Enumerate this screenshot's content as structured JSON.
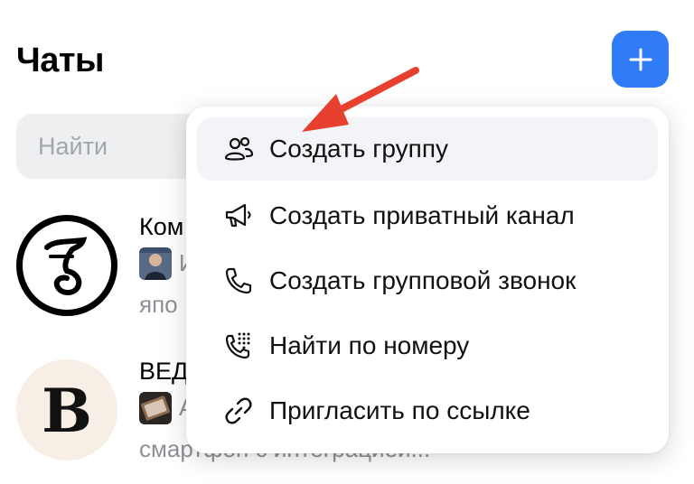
{
  "header": {
    "title": "Чаты",
    "add_icon": "plus-icon",
    "accent_color": "#2f7cf6"
  },
  "search": {
    "placeholder": "Найти"
  },
  "chats": [
    {
      "title": "Ком",
      "preview": "И",
      "preview_line2": "япо",
      "avatar_icon": "kommersant-logo"
    },
    {
      "title": "ВЕД",
      "preview": "А",
      "preview_line2": "смартфон с интеграцией...",
      "avatar_icon": "vedomosti-logo"
    }
  ],
  "menu": {
    "items": [
      {
        "label": "Создать группу",
        "icon": "group-icon",
        "active": true
      },
      {
        "label": "Создать приватный канал",
        "icon": "megaphone-icon",
        "active": false
      },
      {
        "label": "Создать групповой звонок",
        "icon": "phone-icon",
        "active": false
      },
      {
        "label": "Найти по номеру",
        "icon": "dialpad-phone-icon",
        "active": false
      },
      {
        "label": "Пригласить по ссылке",
        "icon": "link-icon",
        "active": false
      }
    ]
  },
  "annotation": {
    "arrow_color": "#e8402e"
  }
}
